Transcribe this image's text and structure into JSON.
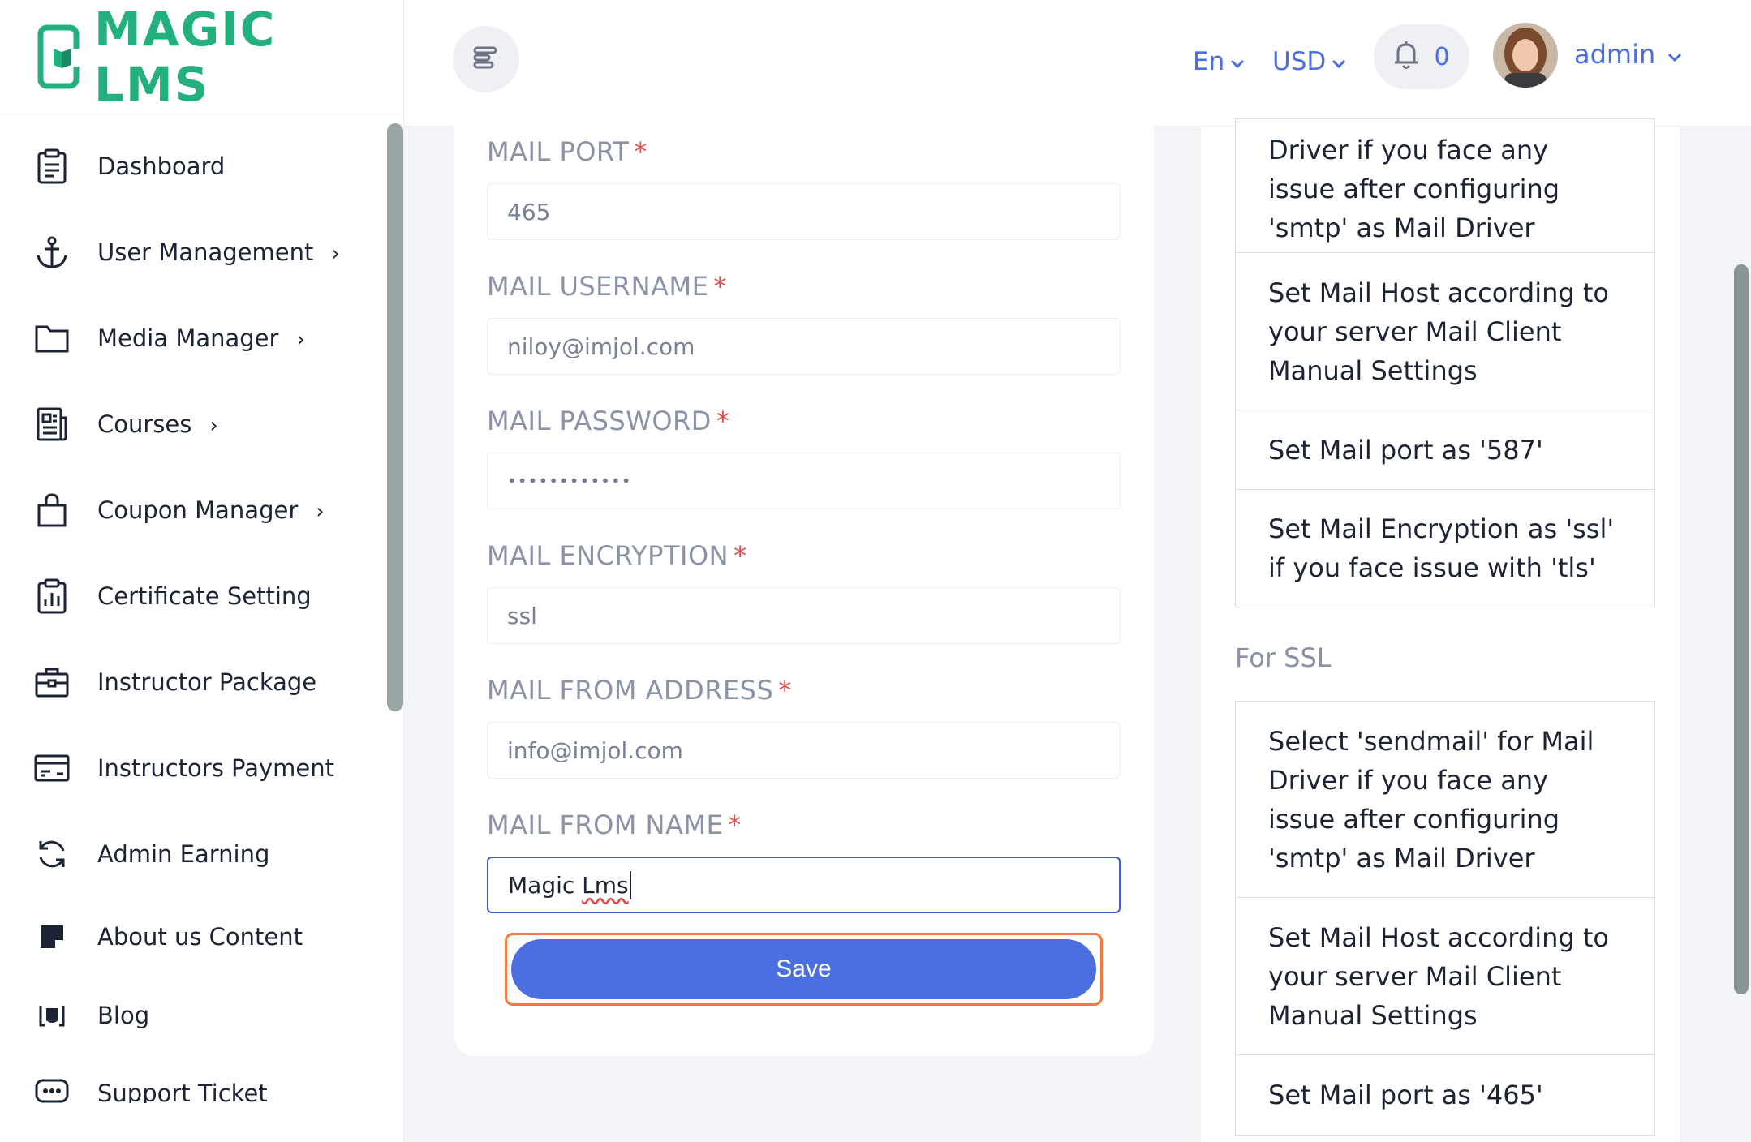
{
  "brand": {
    "name": "MAGIC LMS",
    "color": "#22b07d"
  },
  "sidebar": {
    "items": [
      {
        "label": "Dashboard",
        "icon": "clipboard-list-icon",
        "has_submenu": false
      },
      {
        "label": "User Management",
        "icon": "anchor-icon",
        "has_submenu": true
      },
      {
        "label": "Media Manager",
        "icon": "folder-icon",
        "has_submenu": true
      },
      {
        "label": "Courses",
        "icon": "newspaper-icon",
        "has_submenu": true
      },
      {
        "label": "Coupon Manager",
        "icon": "shopping-bag-icon",
        "has_submenu": true
      },
      {
        "label": "Certificate Setting",
        "icon": "clipboard-chart-icon",
        "has_submenu": false
      },
      {
        "label": "Instructor Package",
        "icon": "briefcase-icon",
        "has_submenu": false
      },
      {
        "label": "Instructors Payment",
        "icon": "credit-card-icon",
        "has_submenu": false
      },
      {
        "label": "Admin Earning",
        "icon": "refresh-icon",
        "has_submenu": false
      },
      {
        "label": "About us Content",
        "icon": "sticky-note-icon",
        "has_submenu": false
      },
      {
        "label": "Blog",
        "icon": "blog-icon",
        "has_submenu": false
      },
      {
        "label": "Support Ticket",
        "icon": "chat-bubble-icon",
        "has_submenu": false
      }
    ]
  },
  "header": {
    "language": "En",
    "currency": "USD",
    "notification_count": "0",
    "user_name": "admin",
    "accent_color": "#4b6fe0"
  },
  "form": {
    "fields": [
      {
        "label": "MAIL PORT",
        "value": "465"
      },
      {
        "label": "MAIL USERNAME",
        "value": "niloy@imjol.com"
      },
      {
        "label": "MAIL PASSWORD",
        "value": "••••••••••••"
      },
      {
        "label": "MAIL ENCRYPTION",
        "value": "ssl"
      },
      {
        "label": "MAIL FROM ADDRESS",
        "value": "info@imjol.com"
      },
      {
        "label": "MAIL FROM NAME",
        "value_prefix": "Magic ",
        "value_misspelled": "Lms"
      }
    ],
    "save_label": "Save"
  },
  "info": {
    "tls_items": [
      "Driver if you face any issue after configuring 'smtp' as Mail Driver",
      "Set Mail Host according to your server Mail Client Manual Settings",
      "Set Mail port as '587'",
      "Set Mail Encryption as 'ssl' if you face issue with 'tls'"
    ],
    "ssl_heading": "For SSL",
    "ssl_items": [
      "Select 'sendmail' for Mail Driver if you face any issue after configuring 'smtp' as Mail Driver",
      "Set Mail Host according to your server Mail Client Manual Settings",
      "Set Mail port as '465'"
    ]
  }
}
